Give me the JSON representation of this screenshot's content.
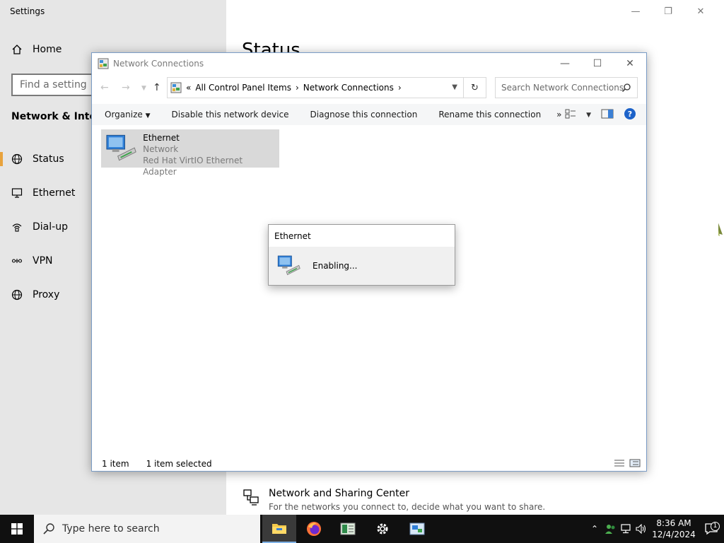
{
  "settings": {
    "window_title": "Settings",
    "controls": [
      "minimize-icon",
      "restore-icon",
      "close-icon"
    ],
    "home_label": "Home",
    "search_placeholder": "Find a setting",
    "section_title": "Network & Internet",
    "nav_items": [
      {
        "label": "Status",
        "icon": "globe-icon",
        "active": true
      },
      {
        "label": "Ethernet",
        "icon": "monitor-icon"
      },
      {
        "label": "Dial-up",
        "icon": "dialup-icon"
      },
      {
        "label": "VPN",
        "icon": "vpn-icon"
      },
      {
        "label": "Proxy",
        "icon": "globe-icon"
      }
    ],
    "page_heading": "Status",
    "sharing_center": {
      "title": "Network and Sharing Center",
      "description": "For the networks you connect to, decide what you want to share."
    }
  },
  "network_connections": {
    "window_title": "Network Connections",
    "breadcrumbs": [
      "All Control Panel Items",
      "Network Connections"
    ],
    "search_placeholder": "Search Network Connections",
    "commands": [
      "Organize",
      "Disable this network device",
      "Diagnose this connection",
      "Rename this connection"
    ],
    "more_commands": "»",
    "adapter": {
      "name": "Ethernet",
      "status": "Network",
      "device": "Red Hat VirtIO Ethernet Adapter"
    },
    "status_count": "1 item",
    "status_selected": "1 item selected"
  },
  "dialog": {
    "title": "Ethernet",
    "message": "Enabling..."
  },
  "taskbar": {
    "search_placeholder": "Type here to search",
    "apps": [
      "file-explorer-icon",
      "firefox-icon",
      "notepad-icon",
      "settings-gear-icon",
      "network-connections-icon"
    ],
    "time": "8:36 AM",
    "date": "12/4/2024",
    "notification_count": "1"
  }
}
